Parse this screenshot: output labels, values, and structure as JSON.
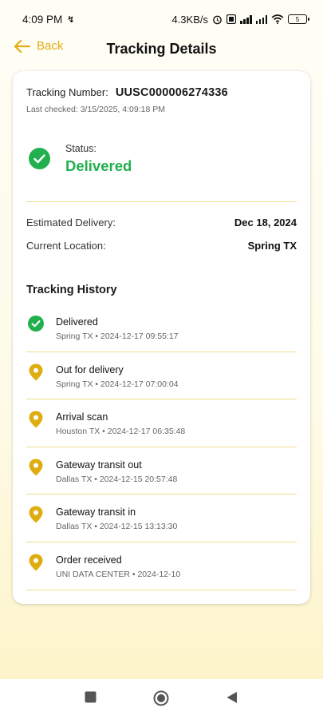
{
  "status_bar": {
    "time": "4:09 PM",
    "speed": "4.3KB/s",
    "battery": "5"
  },
  "header": {
    "back_label": "Back",
    "title": "Tracking Details"
  },
  "tracking": {
    "number_label": "Tracking Number:",
    "number": "UUSC000006274336",
    "last_checked": "Last checked: 3/15/2025, 4:09:18 PM",
    "status_label": "Status:",
    "status_value": "Delivered",
    "estimated_label": "Estimated Delivery:",
    "estimated_value": "Dec 18, 2024",
    "location_label": "Current Location:",
    "location_value": "Spring TX"
  },
  "history": {
    "title": "Tracking History",
    "events": [
      {
        "event": "Delivered",
        "meta": "Spring TX • 2024-12-17 09:55:17",
        "icon": "check-circle-icon"
      },
      {
        "event": "Out for delivery",
        "meta": "Spring TX • 2024-12-17 07:00:04",
        "icon": "location-pin-icon"
      },
      {
        "event": "Arrival scan",
        "meta": "Houston TX • 2024-12-17 06:35:48",
        "icon": "location-pin-icon"
      },
      {
        "event": "Gateway transit out",
        "meta": "Dallas TX • 2024-12-15 20:57:48",
        "icon": "location-pin-icon"
      },
      {
        "event": "Gateway transit in",
        "meta": "Dallas TX • 2024-12-15 13:13:30",
        "icon": "location-pin-icon"
      },
      {
        "event": "Order received",
        "meta": "UNI DATA CENTER • 2024-12-10",
        "icon": "location-pin-icon"
      }
    ]
  },
  "colors": {
    "accent": "#e0ad10",
    "success": "#22b04f",
    "divider": "#f0dc8e"
  }
}
